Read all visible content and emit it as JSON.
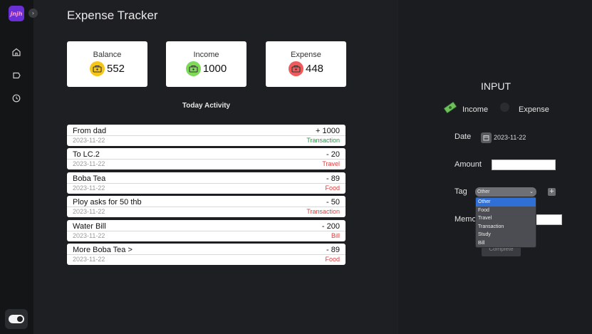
{
  "app": {
    "logo_text": "jnjh",
    "title": "Expense Tracker"
  },
  "sidebar": {
    "items": [
      {
        "name": "home",
        "icon": "home-icon"
      },
      {
        "name": "tag",
        "icon": "tag-icon"
      },
      {
        "name": "history",
        "icon": "history-icon"
      }
    ],
    "theme_toggle": {
      "icon": "toggle-icon",
      "on": true
    }
  },
  "summary": {
    "balance": {
      "label": "Balance",
      "value": "552",
      "color": "#f5c518"
    },
    "income": {
      "label": "Income",
      "value": "1000",
      "color": "#7ed957"
    },
    "expense": {
      "label": "Expense",
      "value": "448",
      "color": "#f05a5a"
    }
  },
  "activity": {
    "heading": "Today Activity",
    "items": [
      {
        "title": "From dad",
        "date": "2023-11-22",
        "amount": "+ 1000",
        "category": "Transaction",
        "category_color": "#1a9c3c"
      },
      {
        "title": "To LC.2",
        "date": "2023-11-22",
        "amount": "- 20",
        "category": "Travel",
        "category_color": "#e03a3a"
      },
      {
        "title": "Boba Tea",
        "date": "2023-11-22",
        "amount": "- 89",
        "category": "Food",
        "category_color": "#e03a3a"
      },
      {
        "title": "Ploy asks for 50 thb",
        "date": "2023-11-22",
        "amount": "- 50",
        "category": "Transaction",
        "category_color": "#e03a3a"
      },
      {
        "title": "Water Bill",
        "date": "2023-11-22",
        "amount": "- 200",
        "category": "Bill",
        "category_color": "#e03a3a"
      },
      {
        "title": "More Boba Tea >",
        "date": "2023-11-22",
        "amount": "- 89",
        "category": "Food",
        "category_color": "#e03a3a"
      }
    ]
  },
  "input_panel": {
    "title": "INPUT",
    "type_options": {
      "income": "Income",
      "expense": "Expense"
    },
    "date_label": "Date",
    "date_value": "2023-11-22",
    "amount_label": "Amount",
    "tag_label": "Tag",
    "tag_selected": "Other",
    "tag_options": [
      "Other",
      "Food",
      "Travel",
      "Transaction",
      "Study",
      "Bill"
    ],
    "memo_label": "Memo",
    "complete_label": "Complete"
  }
}
